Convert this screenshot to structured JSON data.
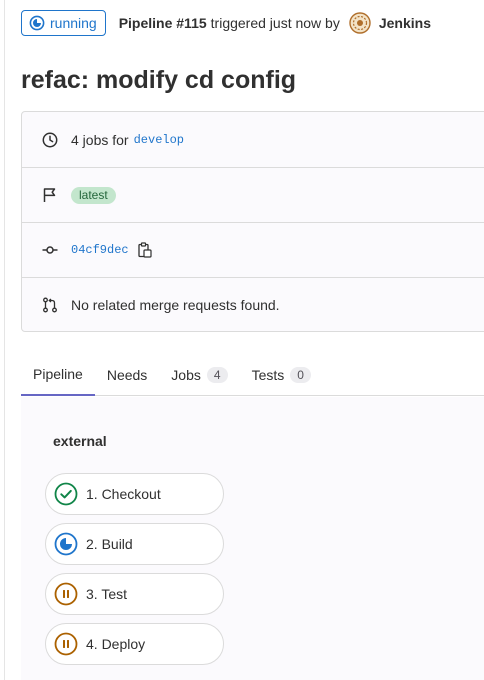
{
  "header": {
    "status": "running",
    "pipeline_label": "Pipeline #115",
    "triggered_text": "triggered just now by",
    "user_name": "Jenkins"
  },
  "commit_title": "refac: modify cd config",
  "info": {
    "jobs_text": "4 jobs for",
    "branch": "develop",
    "badge": "latest",
    "commit_sha": "04cf9dec",
    "merge_requests_text": "No related merge requests found."
  },
  "tabs": [
    {
      "label": "Pipeline",
      "active": true
    },
    {
      "label": "Needs"
    },
    {
      "label": "Jobs",
      "count": "4"
    },
    {
      "label": "Tests",
      "count": "0"
    }
  ],
  "graph": {
    "stage_name": "external",
    "jobs": [
      {
        "label": "1. Checkout",
        "status": "success"
      },
      {
        "label": "2. Build",
        "status": "running"
      },
      {
        "label": "3. Test",
        "status": "manual-paused"
      },
      {
        "label": "4. Deploy",
        "status": "manual-paused"
      }
    ]
  },
  "colors": {
    "running_blue": "#1f75cb",
    "success_green": "#108548",
    "paused_amber": "#ab6100",
    "tab_active": "#6666c4",
    "badge_green_bg": "#c3e6cd"
  },
  "icons": [
    "running-icon",
    "avatar",
    "clock-icon",
    "flag-icon",
    "commit-icon",
    "copy-icon",
    "merge-request-icon",
    "success-icon",
    "paused-icon"
  ]
}
